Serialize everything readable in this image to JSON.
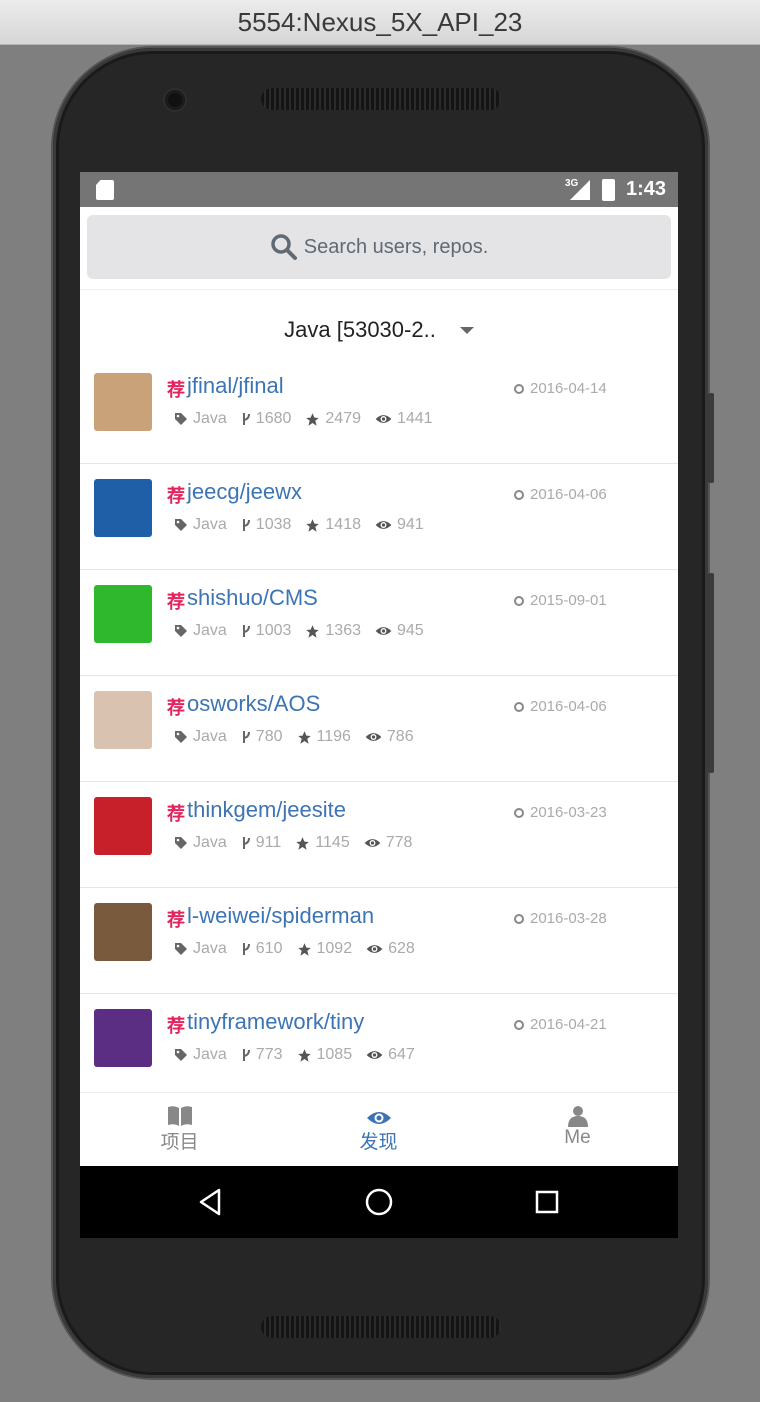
{
  "window": {
    "title": "5554:Nexus_5X_API_23"
  },
  "status_bar": {
    "time": "1:43",
    "network": "3G"
  },
  "search": {
    "placeholder": "Search users, repos."
  },
  "language_filter": {
    "selected": "Java [53030-2.."
  },
  "repos": [
    {
      "badge": "荐",
      "name": "jfinal/jfinal",
      "date": "2016-04-14",
      "language": "Java",
      "forks": "1680",
      "stars": "2479",
      "watchers": "1441",
      "avatar_color": "#c9a27a"
    },
    {
      "badge": "荐",
      "name": "jeecg/jeewx",
      "date": "2016-04-06",
      "language": "Java",
      "forks": "1038",
      "stars": "1418",
      "watchers": "941",
      "avatar_color": "#1f5fa8"
    },
    {
      "badge": "荐",
      "name": "shishuo/CMS",
      "date": "2015-09-01",
      "language": "Java",
      "forks": "1003",
      "stars": "1363",
      "watchers": "945",
      "avatar_color": "#2fb82d"
    },
    {
      "badge": "荐",
      "name": "osworks/AOS",
      "date": "2016-04-06",
      "language": "Java",
      "forks": "780",
      "stars": "1196",
      "watchers": "786",
      "avatar_color": "#d9c3b0"
    },
    {
      "badge": "荐",
      "name": "thinkgem/jeesite",
      "date": "2016-03-23",
      "language": "Java",
      "forks": "911",
      "stars": "1145",
      "watchers": "778",
      "avatar_color": "#c8202a"
    },
    {
      "badge": "荐",
      "name": "l-weiwei/spiderman",
      "date": "2016-03-28",
      "language": "Java",
      "forks": "610",
      "stars": "1092",
      "watchers": "628",
      "avatar_color": "#7a5a3c"
    },
    {
      "badge": "荐",
      "name": "tinyframework/tiny",
      "date": "2016-04-21",
      "language": "Java",
      "forks": "773",
      "stars": "1085",
      "watchers": "647",
      "avatar_color": "#5b2d83"
    }
  ],
  "tabs": [
    {
      "label": "项目",
      "icon": "book-icon"
    },
    {
      "label": "发现",
      "icon": "eye-icon"
    },
    {
      "label": "Me",
      "icon": "user-icon"
    }
  ],
  "colors": {
    "accent": "#3d74b4",
    "badge": "#e0245e",
    "meta": "#aaaaaa"
  }
}
